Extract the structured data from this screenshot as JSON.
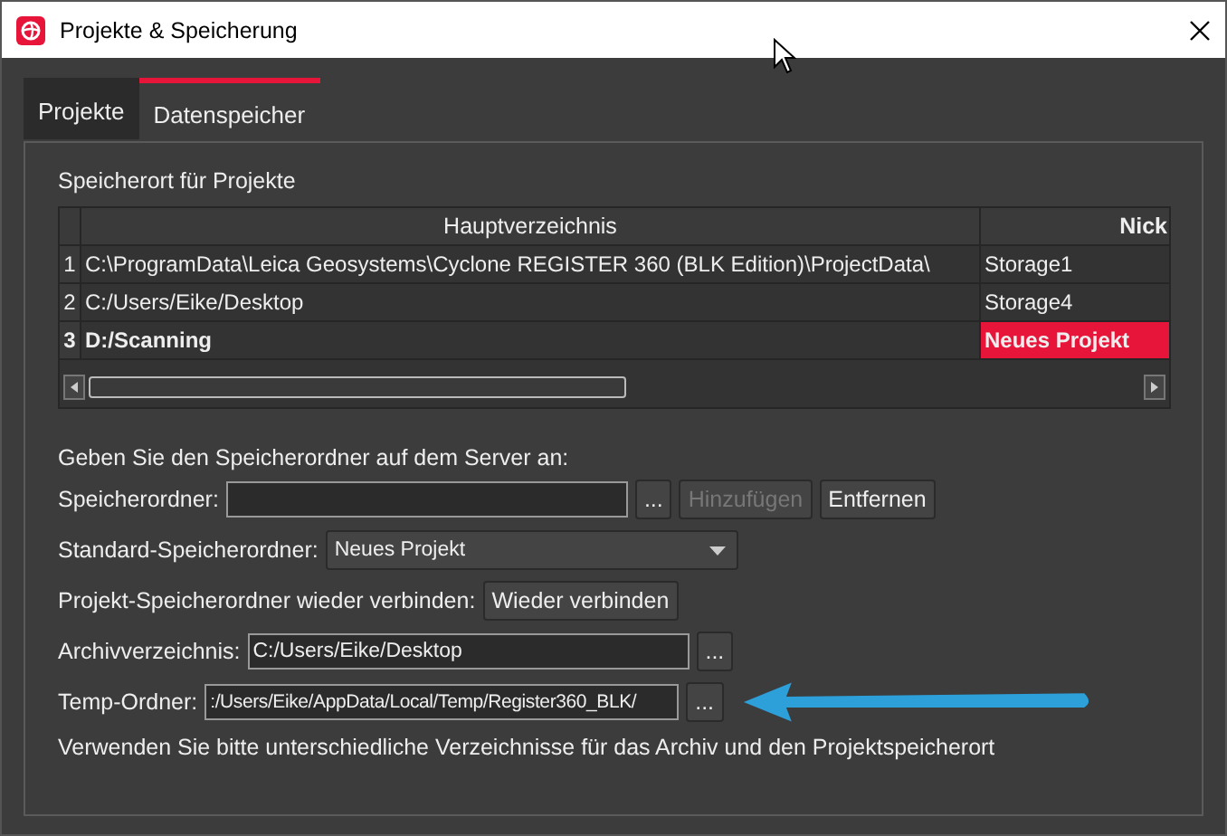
{
  "window": {
    "title": "Projekte & Speicherung"
  },
  "tabs": [
    {
      "label": "Projekte",
      "selected": false
    },
    {
      "label": "Datenspeicher",
      "selected": true
    }
  ],
  "storage_section": {
    "label": "Speicherort für Projekte",
    "table": {
      "columns": [
        "Hauptverzeichnis",
        "Nick"
      ],
      "rows": [
        {
          "index": "1",
          "path": "C:\\ProgramData\\Leica Geosystems\\Cyclone REGISTER 360 (BLK Edition)\\ProjectData\\",
          "nickname": "Storage1",
          "selected": false
        },
        {
          "index": "2",
          "path": "C:/Users/Eike/Desktop",
          "nickname": "Storage4",
          "selected": false
        },
        {
          "index": "3",
          "path": "D:/Scanning",
          "nickname": "Neues Projekt",
          "selected": true
        }
      ]
    }
  },
  "server_hint": "Geben Sie den Speicherordner auf dem Server an:",
  "storage_folder": {
    "label": "Speicherordner:",
    "browse": "...",
    "add": {
      "label": "Hinzufügen",
      "disabled": true
    },
    "remove": {
      "label": "Entfernen",
      "disabled": false
    }
  },
  "default_folder": {
    "label": "Standard-Speicherordner:",
    "value": "Neues Projekt"
  },
  "reconnect": {
    "label": "Projekt-Speicherordner wieder verbinden:",
    "button": "Wieder verbinden"
  },
  "archive": {
    "label": "Archivverzeichnis:",
    "value": "C:/Users/Eike/Desktop",
    "browse": "..."
  },
  "temp": {
    "label": "Temp-Ordner:",
    "value": ":/Users/Eike/AppData/Local/Temp/Register360_BLK/",
    "browse": "..."
  },
  "note": "Verwenden Sie bitte unterschiedliche Verzeichnisse für das Archiv und den Projektspeicherort"
}
